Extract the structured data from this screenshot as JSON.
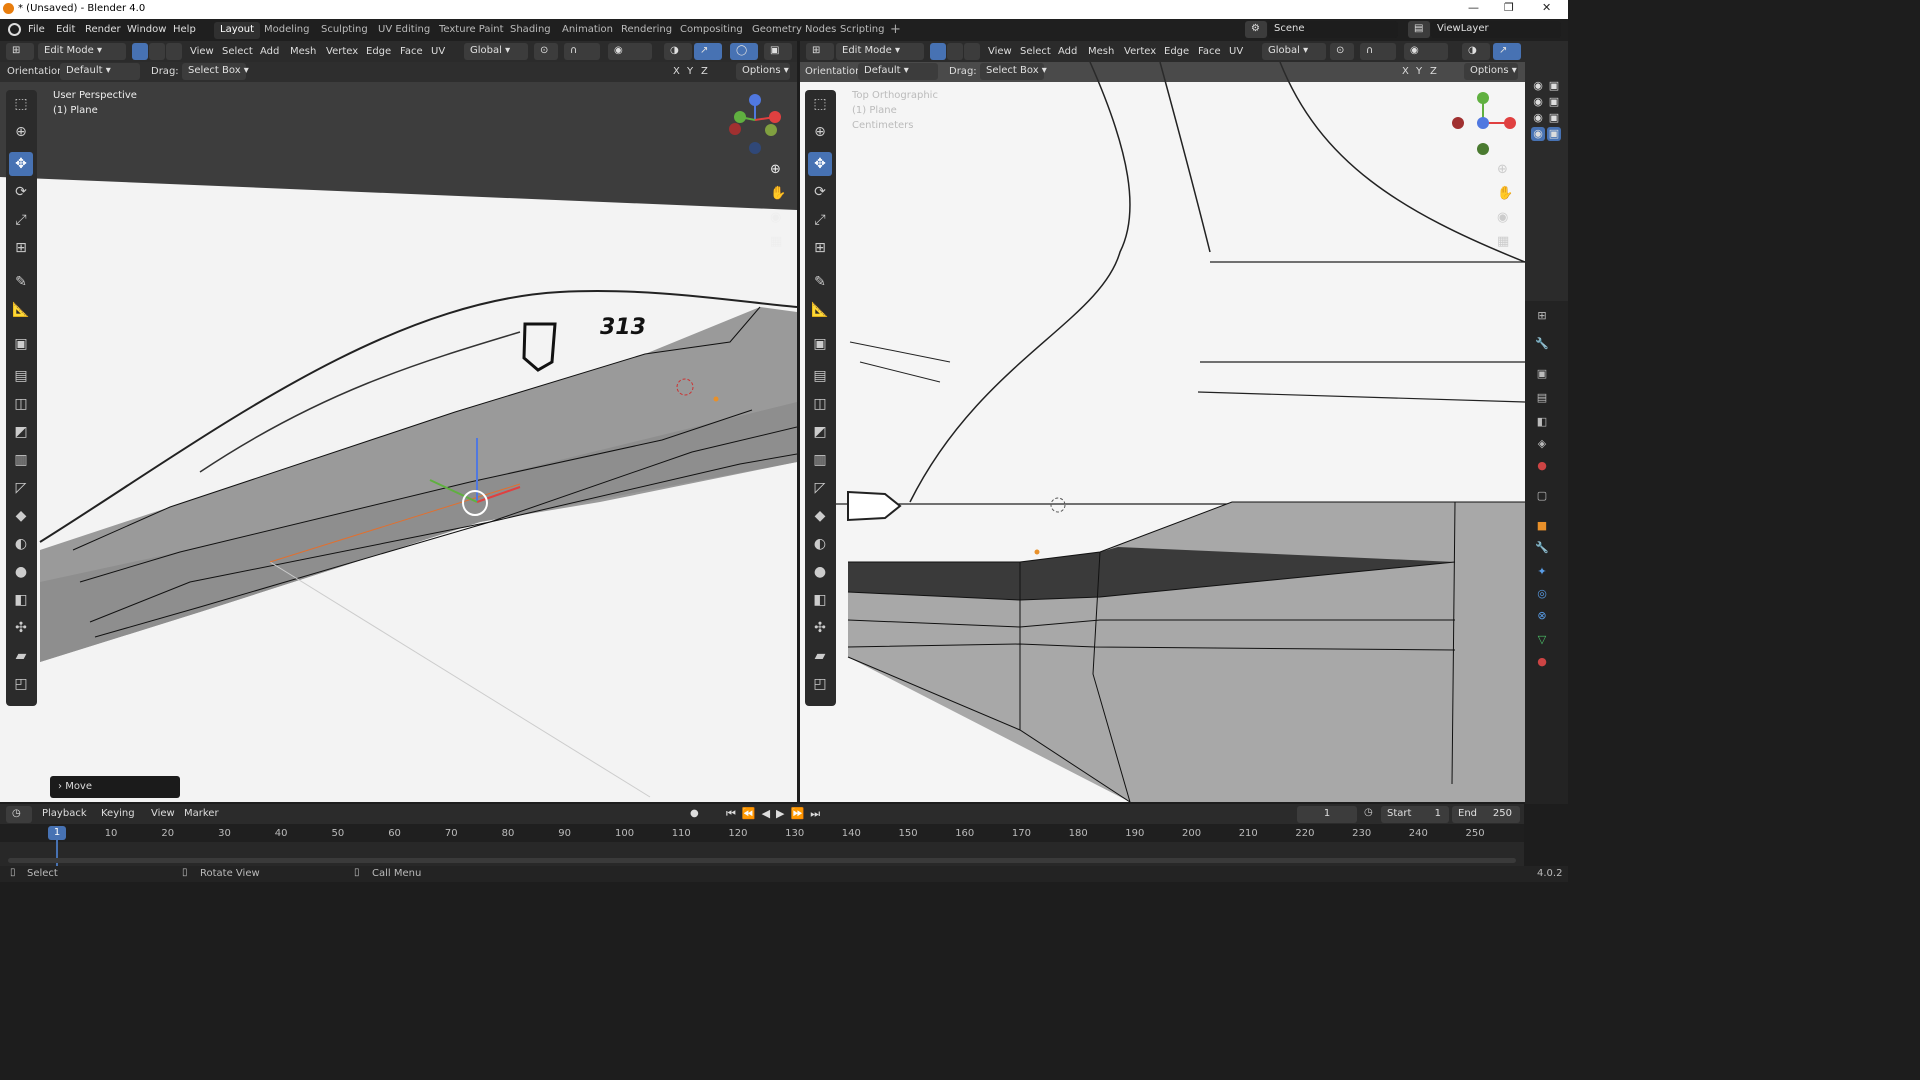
{
  "window": {
    "title": "* (Unsaved) - Blender 4.0",
    "min": "—",
    "max": "❐",
    "close": "✕"
  },
  "menu": [
    "File",
    "Edit",
    "Render",
    "Window",
    "Help"
  ],
  "workspaces": [
    "Layout",
    "Modeling",
    "Sculpting",
    "UV Editing",
    "Texture Paint",
    "Shading",
    "Animation",
    "Rendering",
    "Compositing",
    "Geometry Nodes",
    "Scripting"
  ],
  "scene": "Scene",
  "view_layer": "ViewLayer",
  "left": {
    "mode": "Edit Mode",
    "menus": [
      "View",
      "Select",
      "Add",
      "Mesh",
      "Vertex",
      "Edge",
      "Face",
      "UV"
    ],
    "transform": "Global",
    "orientation_label": "Orientation:",
    "orientation": "Default",
    "drag_label": "Drag:",
    "drag": "Select Box",
    "axes": [
      "X",
      "Y",
      "Z"
    ],
    "options": "Options",
    "overlay1": "User Perspective",
    "overlay2": "(1) Plane",
    "decal_number": "313",
    "last_op": "Move"
  },
  "right": {
    "mode": "Edit Mode",
    "menus": [
      "View",
      "Select",
      "Add",
      "Mesh",
      "Vertex",
      "Edge",
      "Face",
      "UV"
    ],
    "transform": "Global",
    "orientation_label": "Orientation:",
    "orientation": "Default",
    "drag_label": "Drag:",
    "drag": "Select Box",
    "axes": [
      "X",
      "Y",
      "Z"
    ],
    "options": "Options",
    "overlay1": "Top Orthographic",
    "overlay2": "(1) Plane",
    "overlay3": "Centimeters"
  },
  "timeline": {
    "menus": [
      "Playback",
      "Keying",
      "View",
      "Marker"
    ],
    "current_frame": "1",
    "start_label": "Start",
    "start": "1",
    "end_label": "End",
    "end": "250",
    "ticks": [
      "10",
      "20",
      "30",
      "40",
      "50",
      "60",
      "70",
      "80",
      "90",
      "100",
      "110",
      "120",
      "130",
      "140",
      "150",
      "160",
      "170",
      "180",
      "190",
      "200",
      "210",
      "220",
      "230",
      "240",
      "250"
    ]
  },
  "status": {
    "select": "Select",
    "rotate": "Rotate View",
    "call_menu": "Call Menu",
    "version": "4.0.2"
  }
}
